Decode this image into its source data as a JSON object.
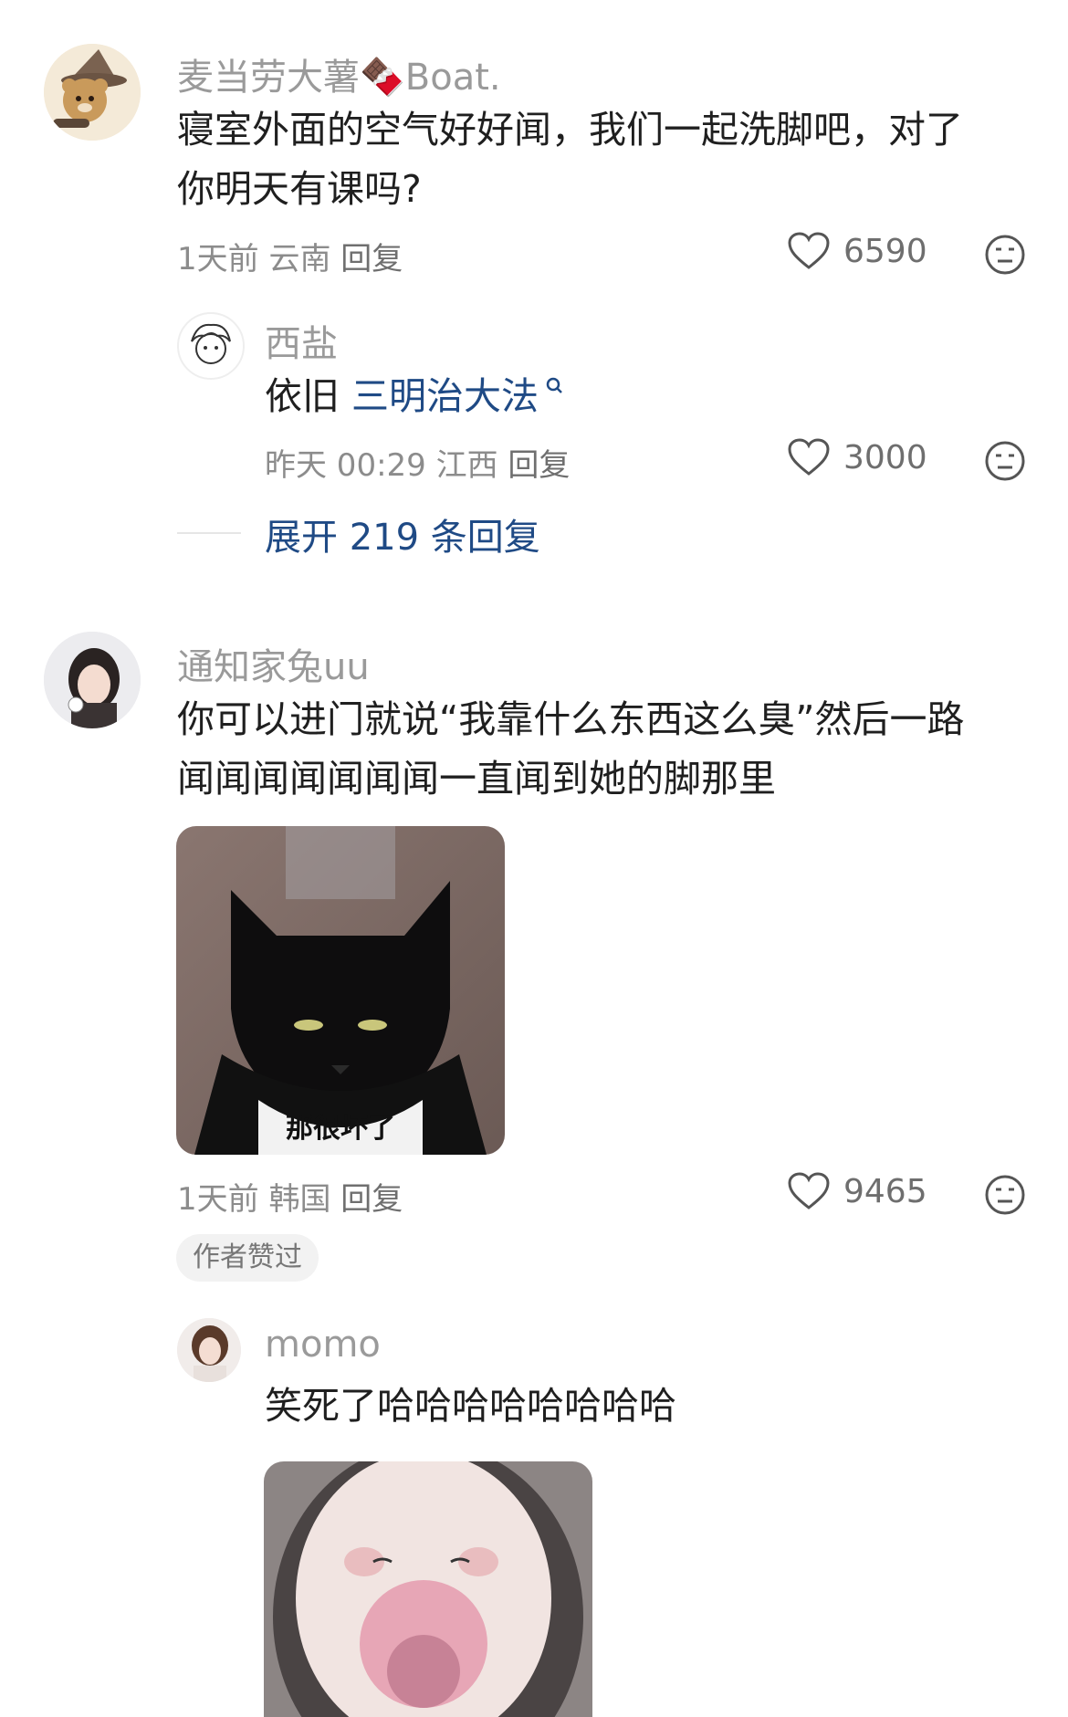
{
  "comments": [
    {
      "username": "麦当劳大薯🍫Boat.",
      "text_line1": "寝室外面的空气好好闻，我们一起洗脚吧，对了",
      "text_line2": "你明天有课吗?",
      "time": "1天前",
      "location": "云南",
      "reply_label": "回复",
      "likes": "6590",
      "replies": [
        {
          "username": "西盐",
          "text_prefix": "依旧",
          "text_link": "三明治大法",
          "time": "昨天 00:29",
          "location": "江西",
          "reply_label": "回复",
          "likes": "3000"
        }
      ],
      "expand_label": "展开 219 条回复"
    },
    {
      "username": "通知家兔uu",
      "text_line1": "你可以进门就说“我靠什么东西这么臭”然后一路",
      "text_line2": "闻闻闻闻闻闻闻一直闻到她的脚那里",
      "image_caption": "那很坏了",
      "time": "1天前",
      "location": "韩国",
      "reply_label": "回复",
      "likes": "9465",
      "badge": "作者赞过",
      "replies": [
        {
          "username": "momo",
          "text": "笑死了哈哈哈哈哈哈哈哈"
        }
      ]
    }
  ],
  "colors": {
    "link": "#1f4a85",
    "username": "#9a9a9a",
    "meta": "#8c8c8c"
  }
}
